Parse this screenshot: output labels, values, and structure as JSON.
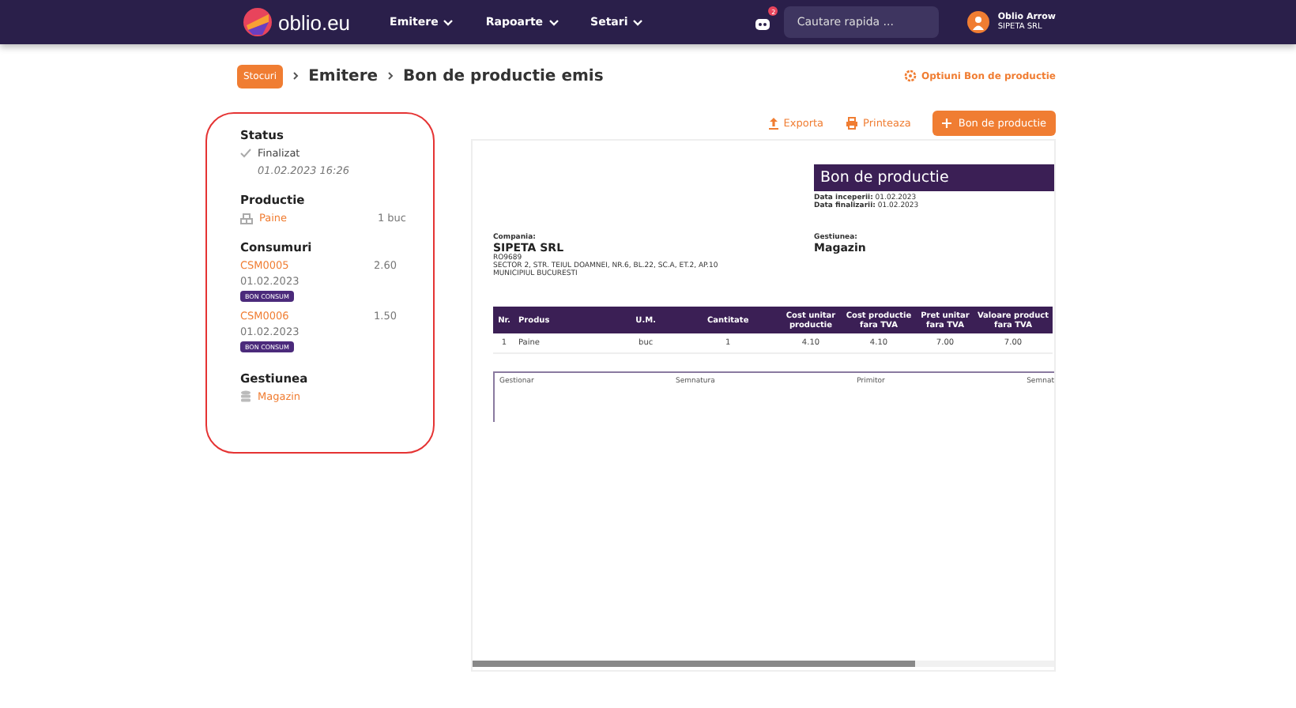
{
  "nav": {
    "logo": "oblio.eu",
    "menu": [
      {
        "label": "Emitere"
      },
      {
        "label": "Rapoarte"
      },
      {
        "label": "Setari"
      }
    ],
    "notifications": "2",
    "search": {
      "placeholder": "Cautare rapida ..."
    },
    "user": {
      "name": "Oblio Arrow",
      "company": "SIPETA SRL"
    }
  },
  "breadcrumb": {
    "badge": "Stocuri",
    "items": [
      "Emitere",
      "Bon de productie emis"
    ],
    "options": "Optiuni Bon de productie"
  },
  "sidebar": {
    "status": {
      "title": "Status",
      "value": "Finalizat",
      "date": "01.02.2023 16:26"
    },
    "productie": {
      "title": "Productie",
      "item": "Paine",
      "qty": "1 buc"
    },
    "consumuri": {
      "title": "Consumuri",
      "items": [
        {
          "code": "CSM0005",
          "value": "2.60",
          "date": "01.02.2023",
          "tag": "BON CONSUM"
        },
        {
          "code": "CSM0006",
          "value": "1.50",
          "date": "01.02.2023",
          "tag": "BON CONSUM"
        }
      ]
    },
    "gestiunea": {
      "title": "Gestiunea",
      "value": "Magazin"
    }
  },
  "actions": {
    "export": "Exporta",
    "print": "Printeaza",
    "add": "Bon de productie"
  },
  "document": {
    "title": "Bon de productie",
    "dates": [
      {
        "label": "Data inceperii:",
        "value": "01.02.2023"
      },
      {
        "label": "Data finalizarii:",
        "value": "01.02.2023"
      }
    ],
    "company": {
      "label": "Compania:",
      "name": "SIPETA SRL",
      "code": "RO9689",
      "address": "SECTOR 2, STR. TEIUL DOAMNEI, NR.6, BL.22, SC.A, ET.2, AP.10",
      "city": "MUNICIPIUL BUCURESTI"
    },
    "gestiune": {
      "label": "Gestiunea:",
      "name": "Magazin"
    },
    "table": {
      "columns": [
        "Nr.",
        "Produs",
        "U.M.",
        "Cantitate",
        "Cost unitar productie",
        "Cost productie fara TVA",
        "Pret unitar fara TVA",
        "Valoare product fara TVA"
      ],
      "rows": [
        [
          "1",
          "Paine",
          "buc",
          "1",
          "4.10",
          "4.10",
          "7.00",
          "7.00"
        ]
      ]
    },
    "signatures": [
      "Gestionar",
      "Semnatura",
      "Primitor",
      "Semnat"
    ]
  }
}
